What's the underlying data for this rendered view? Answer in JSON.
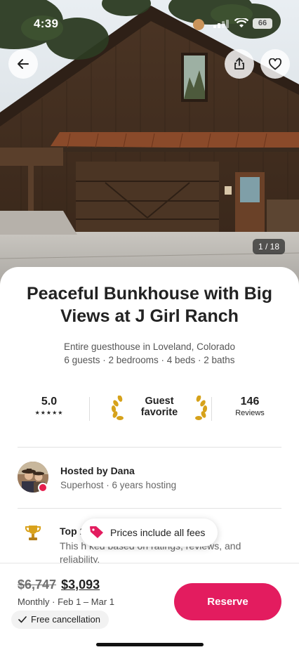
{
  "status_bar": {
    "time": "4:39",
    "battery": "66"
  },
  "photos": {
    "counter": "1 / 18"
  },
  "listing": {
    "title": "Peaceful Bunkhouse with Big Views at J Girl Ranch",
    "type_location": "Entire guesthouse in Loveland, Colorado",
    "details": "6 guests · 2 bedrooms · 4 beds · 2 baths"
  },
  "stats": {
    "rating": "5.0",
    "stars": "★★★★★",
    "guest_favorite_line1": "Guest",
    "guest_favorite_line2": "favorite",
    "review_count": "146",
    "reviews_label": "Reviews"
  },
  "host": {
    "hosted_by": "Hosted by Dana",
    "meta": "Superhost · 6 years hosting"
  },
  "highlight": {
    "heading": "Top 1",
    "body": "This h                                        ked based on ratings, reviews, and reliability."
  },
  "fees_banner": {
    "text": "Prices include all fees"
  },
  "booking": {
    "old_price": "$6,747",
    "new_price": "$3,093",
    "dates": "Monthly · Feb 1 – Mar 1",
    "free_cancellation": "Free cancellation",
    "reserve_label": "Reserve"
  },
  "colors": {
    "brand": "#e31c5f",
    "text": "#222222",
    "muted": "#717171"
  }
}
